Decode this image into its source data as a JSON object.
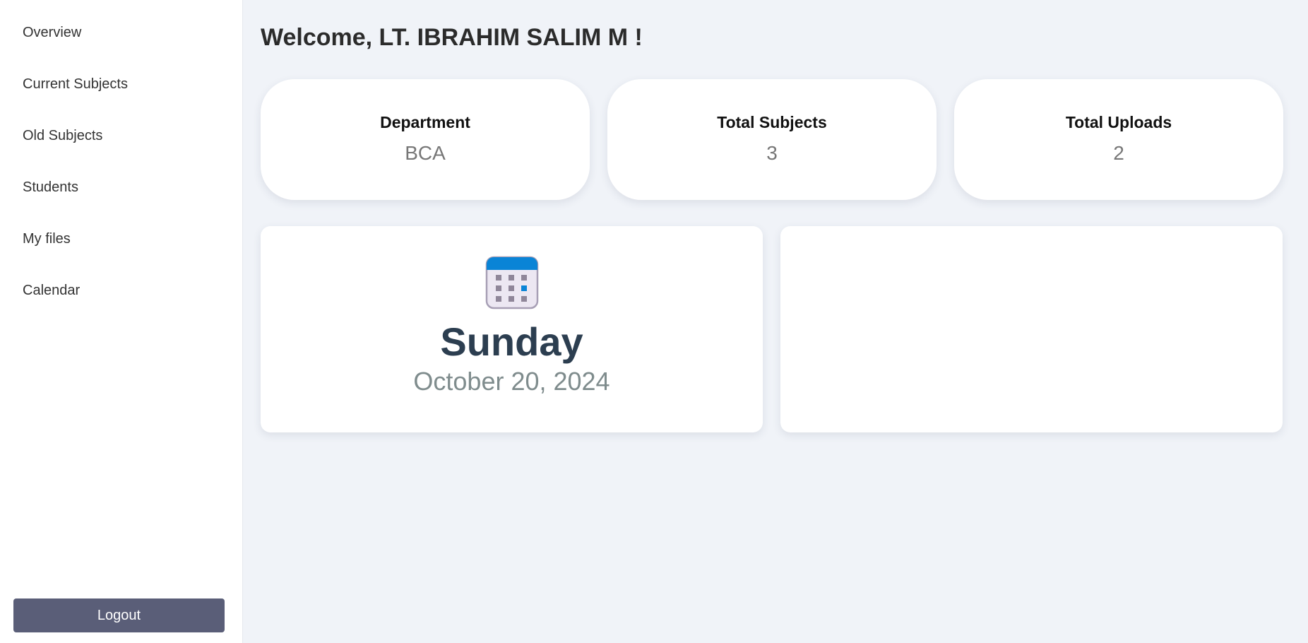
{
  "sidebar": {
    "items": [
      {
        "label": "Overview"
      },
      {
        "label": "Current Subjects"
      },
      {
        "label": "Old Subjects"
      },
      {
        "label": "Students"
      },
      {
        "label": "My files"
      },
      {
        "label": "Calendar"
      }
    ],
    "logout_label": "Logout"
  },
  "header": {
    "title": "Welcome, LT. IBRAHIM SALIM M !"
  },
  "stats": [
    {
      "label": "Department",
      "value": "BCA"
    },
    {
      "label": "Total Subjects",
      "value": "3"
    },
    {
      "label": "Total Uploads",
      "value": "2"
    }
  ],
  "today": {
    "icon": "calendar-icon",
    "day": "Sunday",
    "date": "October 20, 2024"
  },
  "colors": {
    "background": "#f0f3f8",
    "logout_button": "#5a5e78",
    "calendar_accent": "#0a84d6",
    "day_text": "#2c3e50"
  }
}
